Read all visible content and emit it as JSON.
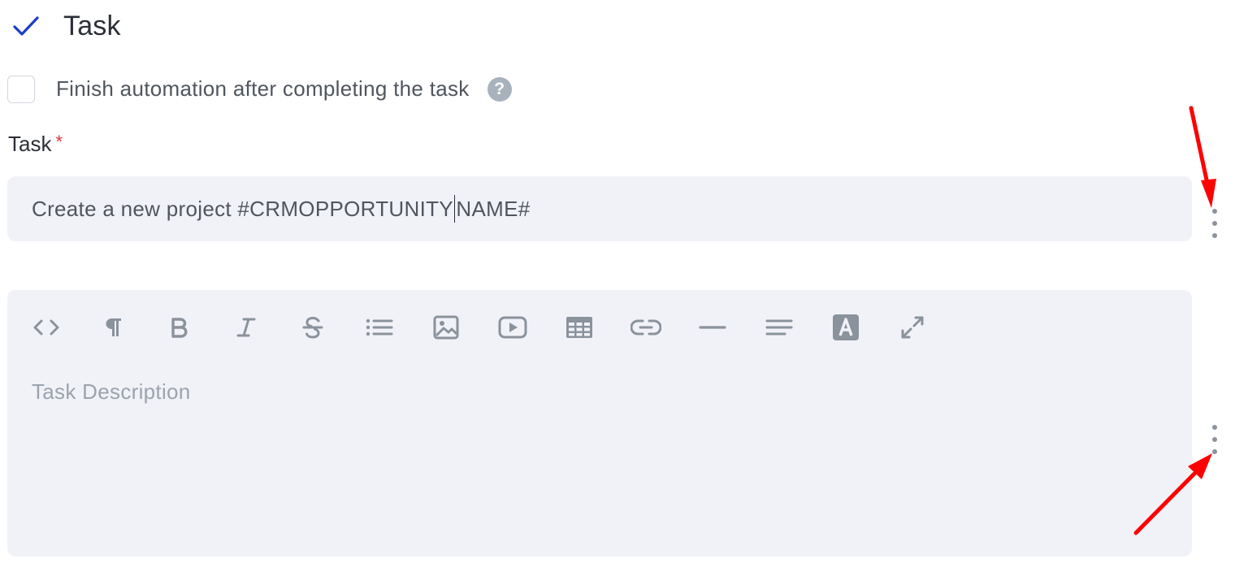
{
  "header": {
    "title": "Task",
    "check_icon": "checkmark-icon",
    "check_color": "#1a3ec9"
  },
  "option": {
    "checked": false,
    "label": "Finish automation after completing the task",
    "help_icon": "?"
  },
  "task_field": {
    "label": "Task",
    "required_marker": "*",
    "value_before_caret": "Create a new project #CRMOPPORTUNITY",
    "value_after_caret": "NAME#"
  },
  "description_editor": {
    "placeholder": "Task Description",
    "toolbar": [
      "code-view-icon",
      "paragraph-icon",
      "bold-icon",
      "italic-icon",
      "strikethrough-icon",
      "bullet-list-icon",
      "image-icon",
      "video-icon",
      "table-icon",
      "link-icon",
      "horizontal-rule-icon",
      "align-icon",
      "text-color-icon",
      "fullscreen-icon"
    ]
  },
  "colors": {
    "icon_gray": "#8a929c",
    "field_bg": "#f1f2f7",
    "required": "#e0343b",
    "annotation_arrow": "#ff0000"
  }
}
